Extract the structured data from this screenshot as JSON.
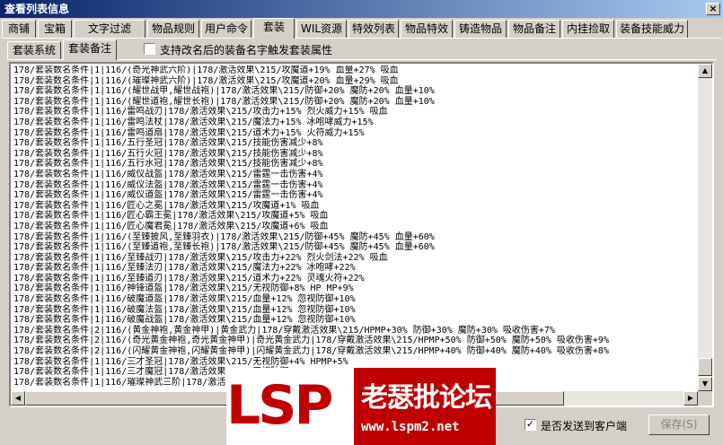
{
  "window": {
    "title": "查看列表信息",
    "close": "×"
  },
  "tabs": [
    "商铺",
    "宝箱",
    "文字过滤",
    "物品规则",
    "用户命令",
    "套装",
    "WIL资源",
    "特效列表",
    "物品特效",
    "铸造物品",
    "物品备注",
    "内挂捡取",
    "装备技能威力"
  ],
  "subtabs": [
    "套装系统",
    "套装备注"
  ],
  "checkbox_rename": {
    "label": "支持改名后的装备名字触发套装属性",
    "checked": false
  },
  "checkbox_send": {
    "label": "是否发送到客户端",
    "checked": true
  },
  "save_button": "保存(S)",
  "scroll": {
    "up": "▲",
    "down": "▼",
    "left": "◀",
    "right": "▶"
  },
  "lines": [
    "178/套装数名条件|1|116/(奇光神武六阶)|178/激活效果\\215/攻魔道+19% 血量+27% 吸血",
    "178/套装数名条件|1|116/(璀璨神武六阶)|178/激活效果\\215/攻魔道+20% 血量+29% 吸血",
    "178/套装数名条件|1|116/(耀世战甲,耀世战袍)|178/激活效果\\215/防御+20% 魔防+20% 血量+10%",
    "178/套装数名条件|1|116/(耀世道袍,耀世长袍)|178/激活效果\\215/防御+20% 魔防+20% 血量+10%",
    "178/套装数名条件|1|116/雷鸣战刃|178/激活效果\\215/攻击力+15% 烈火威力+15% 吸血",
    "178/套装数名条件|1|116/雷鸣法杖|178/激活效果\\215/魔法力+15% 冰咆哮威力+15%",
    "178/套装数名条件|1|116/雷鸣道扇|178/激活效果\\215/道术力+15% 火符威力+15%",
    "178/套装数名条件|1|116/五行圣冠|178/激活效果\\215/技能伤害减少+8%",
    "178/套装数名条件|1|116/五行火冠|178/激活效果\\215/技能伤害减少+8%",
    "178/套装数名条件|1|116/五行水冠|178/激活效果\\215/技能伤害减少+8%",
    "178/套装数名条件|1|116/威仪战盔|178/激活效果\\215/雷霆一击伤害+4%",
    "178/套装数名条件|1|116/威仪法盔|178/激活效果\\215/雷霆一击伤害+4%",
    "178/套装数名条件|1|116/威仪道盔|178/激活效果\\215/雷霆一击伤害+4%",
    "178/套装数名条件|1|116/匠心之冕|178/激活效果\\215/攻魔道+1% 吸血",
    "178/套装数名条件|1|116/匠心霸王冕|178/激活效果\\215/攻魔道+5% 吸血",
    "178/套装数名条件|1|116/匠心魔君冕|178/激活效果\\215/攻魔道+6% 吸血",
    "178/套装数名条件|1|116/(至臻披风,至臻羽衣)|178/激活效果\\215/防御+45% 魔防+45% 血量+60%",
    "178/套装数名条件|1|116/(至臻道袍,至臻长袍)|178/激活效果\\215/防御+45% 魔防+45% 血量+60%",
    "178/套装数名条件|1|116/至臻战刃|178/激活效果\\215/攻击力+22% 烈火剑法+22% 吸血",
    "178/套装数名条件|1|116/至臻法刃|178/激活效果\\215/魔法力+22% 冰咆哮+22%",
    "178/套装数名条件|1|116/至臻道刃|178/激活效果\\215/道术力+22% 灵魂火符+22%",
    "178/套装数名条件|1|116/神锋道盔|178/激活效果\\215/无视防御+8% HP MP+9%",
    "178/套装数名条件|1|116/破魔道盔|178/激活效果\\215/血量+12% 忽视防御+10%",
    "178/套装数名条件|1|116/破魔法盔|178/激活效果\\215/血量+12% 忽视防御+10%",
    "178/套装数名条件|1|116/破魔战盔|178/激活效果\\215/血量+12% 忽视防御+10%",
    "178/套装数名条件|2|116/(黄金神袍,黄金神甲)|黄金武力|178/穿戴激活效果\\215/HPMP+30% 防御+30% 魔防+30% 吸收伤害+7%",
    "178/套装数名条件|2|116/(奇光黄金神袍,奇光黄金神甲)|奇光黄金武力|178/穿戴激活效果\\215/HPMP+50% 防御+50% 魔防+50% 吸收伤害+9%",
    "178/套装数名条件|2|116/(闪耀黄金神袍,闪耀黄金神甲)|闪耀黄金武力|178/穿戴激活效果\\215/HPMP+40% 防御+40% 魔防+40% 吸收伤害+8%",
    "178/套装数名条件|1|116/三才圣冠|178/激活效果\\215/无视防御+4% HPMP+5%",
    "178/套装数名条件|1|116/三才魔冠|178/激活效果\\215/无视防御+4% HPMP+5%",
    "178/套装数名条件|1|116/璀璨神武三阶|178/激活效果\\215/攻魔道+10% 血量+15% 吸血"
  ],
  "watermark": {
    "logo": "LSP",
    "name": "老瑟批论坛",
    "url": "www.lspm2.net"
  }
}
